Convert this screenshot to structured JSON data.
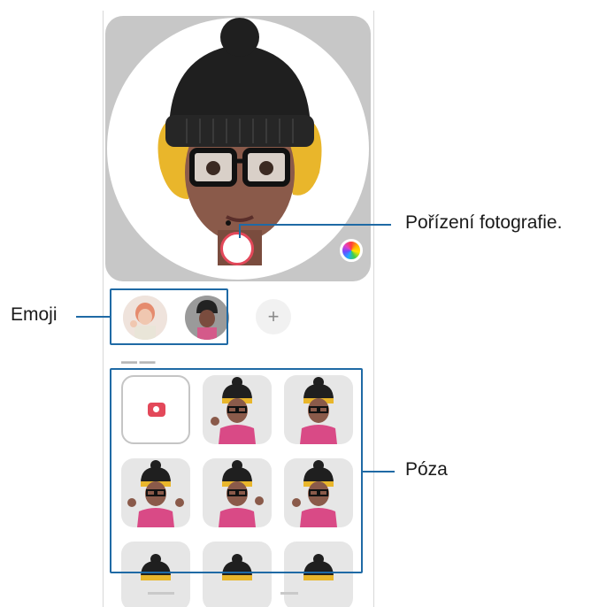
{
  "callouts": {
    "shutter": "Pořízení fotografie.",
    "emoji": "Emoji",
    "pose": "Póza"
  },
  "emoji_bar": {
    "add_symbol": "+"
  },
  "icons": {
    "shutter": "shutter-button",
    "color": "color-wheel-icon",
    "camera": "camera-icon",
    "add": "plus-icon"
  },
  "colors": {
    "accent": "#e3485a",
    "callout": "#1f6aa5",
    "tile": "#e6e6e6"
  }
}
